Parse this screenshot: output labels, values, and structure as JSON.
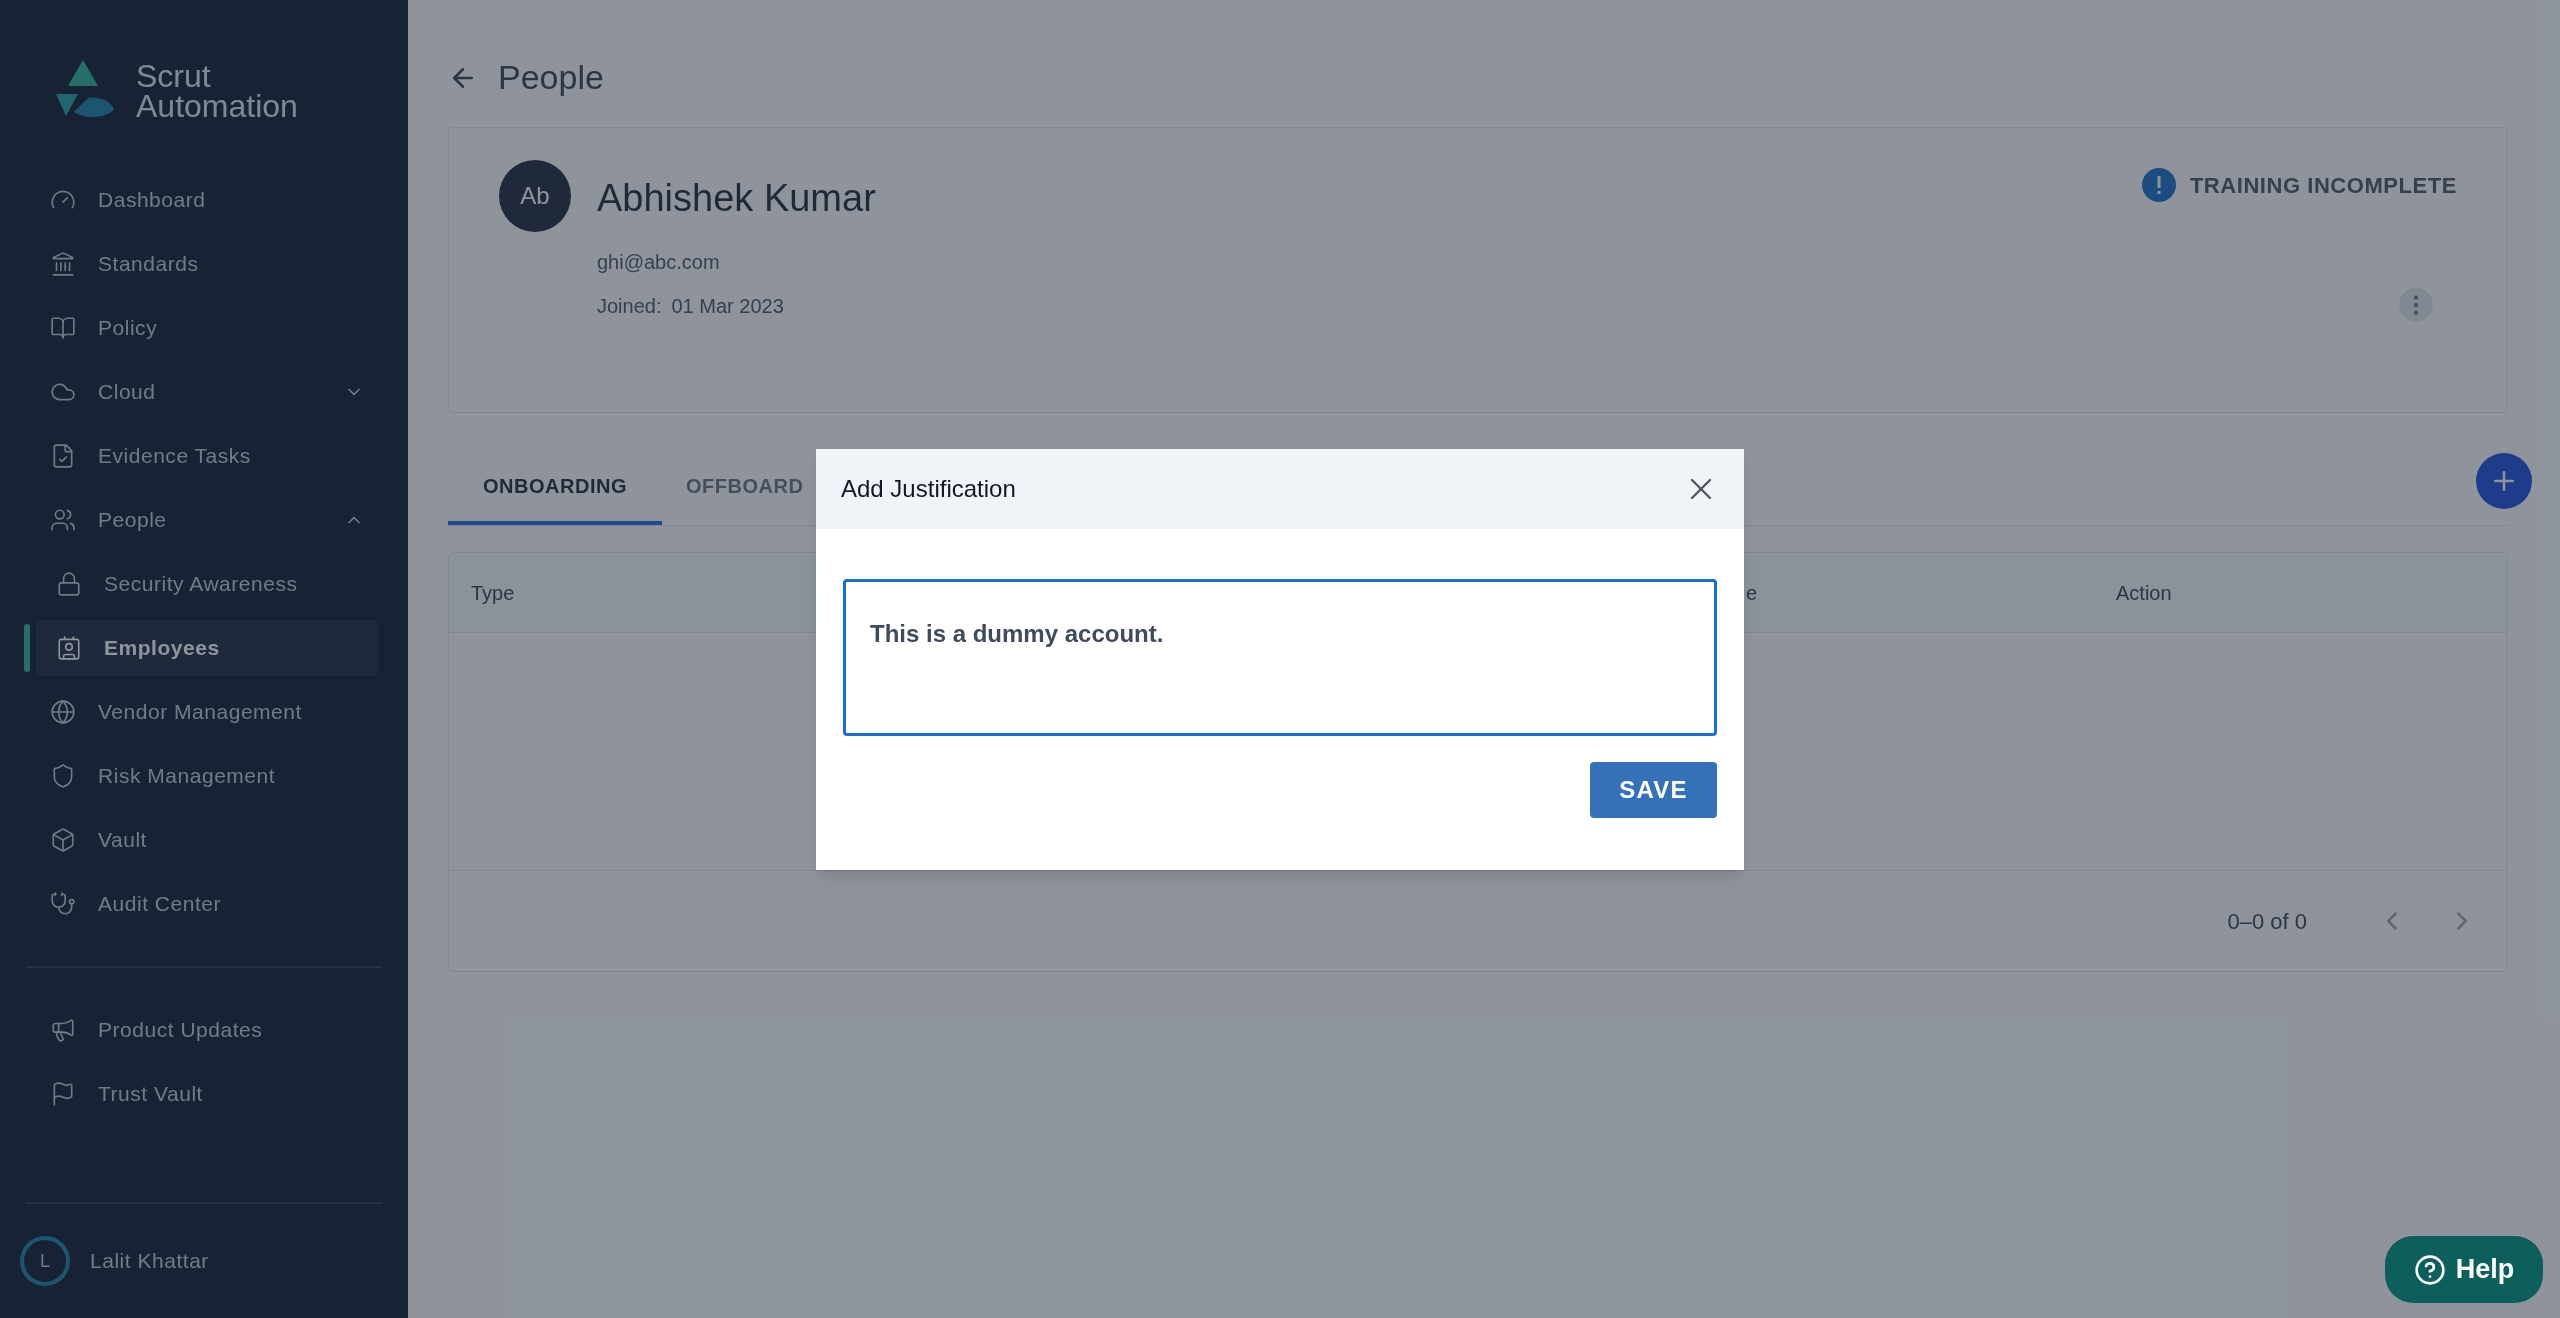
{
  "sidebar": {
    "logo": {
      "line1": "Scrut",
      "line2": "Automation"
    },
    "items": [
      {
        "label": "Dashboard",
        "selected": false
      },
      {
        "label": "Standards",
        "selected": false
      },
      {
        "label": "Policy",
        "selected": false
      },
      {
        "label": "Cloud",
        "selected": false,
        "expanded": false
      },
      {
        "label": "Evidence Tasks",
        "selected": false
      },
      {
        "label": "People",
        "selected": false,
        "expanded": true,
        "children": [
          {
            "label": "Security Awareness",
            "selected": false
          },
          {
            "label": "Employees",
            "selected": true
          }
        ]
      },
      {
        "label": "Vendor Management",
        "selected": false
      },
      {
        "label": "Risk Management",
        "selected": false
      },
      {
        "label": "Vault",
        "selected": false
      },
      {
        "label": "Audit Center",
        "selected": false
      }
    ],
    "footer_items": [
      {
        "label": "Product Updates",
        "selected": false
      },
      {
        "label": "Trust Vault",
        "selected": false
      }
    ],
    "user": {
      "initial": "L",
      "name": "Lalit Khattar"
    }
  },
  "page": {
    "title": "People",
    "profile": {
      "initials": "Ab",
      "name": "Abhishek Kumar",
      "email": "ghi@abc.com",
      "joined_label": "Joined:",
      "joined_date": "01 Mar 2023",
      "status": "TRAINING INCOMPLETE"
    },
    "tabs": [
      {
        "label": "ONBOARDING",
        "selected": true
      },
      {
        "label": "OFFBOARD",
        "selected": false
      }
    ],
    "table": {
      "columns": [
        "Type",
        "e",
        "Action"
      ],
      "pagination": "0–0 of 0"
    }
  },
  "dialog": {
    "title": "Add Justification",
    "value": "This is a dummy account.",
    "save": "SAVE"
  },
  "help": "Help"
}
